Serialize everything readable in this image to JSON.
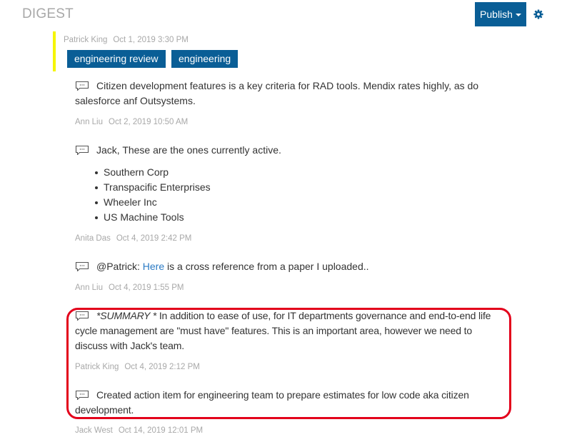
{
  "header": {
    "title": "DIGEST",
    "publish_label": "Publish",
    "settings_icon": "gear-icon"
  },
  "post": {
    "author": "Patrick King",
    "date": "Oct 1, 2019 3:30 PM",
    "tags": [
      "engineering review",
      "engineering"
    ]
  },
  "comments": [
    {
      "icon": "comment-icon",
      "text_line1": "Citizen development features is a key criteria for RAD tools. Mendix rates highly, as do",
      "text_line2": "salesforce anf Outsystems.",
      "author": "Ann Liu",
      "date": "Oct 2, 2019 10:50 AM"
    },
    {
      "icon": "comment-icon",
      "text": "Jack, These are the ones currently active.",
      "list": [
        "Southern Corp",
        "Transpacific Enterprises",
        "Wheeler Inc",
        "US Machine Tools"
      ],
      "author": "Anita Das",
      "date": "Oct 4, 2019 2:42 PM"
    },
    {
      "icon": "comment-icon",
      "text_prefix": "@Patrick: ",
      "link_text": "Here",
      "text_suffix": " is a cross reference from a paper I uploaded..",
      "author": "Ann Liu",
      "date": "Oct 4, 2019 1:55 PM"
    },
    {
      "icon": "comment-icon",
      "emphasis": "*SUMMARY *",
      "text_line1": " In addition to ease of use, for IT departments governance and end-to-end life",
      "text_line2": "cycle management are \"must have\" features. This is an important area, however we need to",
      "text_line3": "discuss with Jack's team.",
      "author": "Patrick King",
      "date": "Oct 4, 2019 2:12 PM"
    },
    {
      "icon": "comment-icon",
      "text_line1": "Created action item for engineering team to prepare estimates for low code aka citizen",
      "text_line2": "development.",
      "author": "Jack West",
      "date": "Oct 14, 2019 12:01 PM"
    }
  ],
  "colors": {
    "accent": "#0a5e96",
    "highlight_border": "#e3001b",
    "post_marker": "#f5f500",
    "link": "#2a7ac4"
  }
}
